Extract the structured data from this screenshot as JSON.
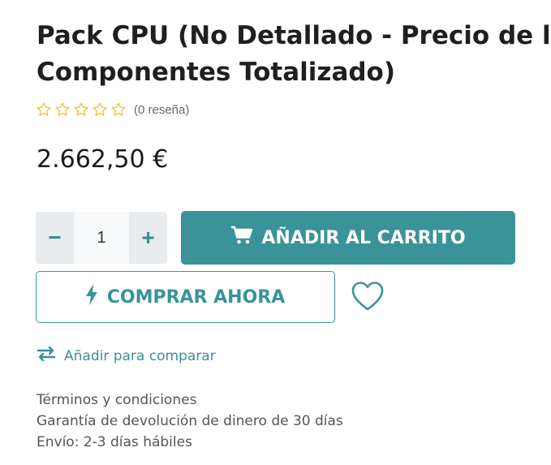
{
  "product": {
    "title_line1": "Pack CPU (No Detallado - Precio de los",
    "title_line2": "Componentes Totalizado)",
    "rating": 0,
    "rating_max": 5,
    "review_count_text": "(0 reseña)",
    "price": "2.662,50 €"
  },
  "quantity": {
    "value": "1",
    "minus_label": "−",
    "plus_label": "+"
  },
  "actions": {
    "add_to_cart": "AÑADIR AL CARRITO",
    "buy_now": "COMPRAR AHORA",
    "compare": "Añadir para comparar"
  },
  "info": [
    "Términos y condiciones",
    "Garantía de devolución de dinero de 30 días",
    "Envío: 2-3 días hábiles"
  ],
  "icons": {
    "cart": "cart-icon",
    "bolt": "bolt-icon",
    "heart": "heart-icon",
    "compare": "compare-arrows-icon",
    "star": "star-outline-icon"
  },
  "colors": {
    "accent": "#3a9399",
    "star": "#f2c230",
    "text": "#1f1f1f"
  }
}
